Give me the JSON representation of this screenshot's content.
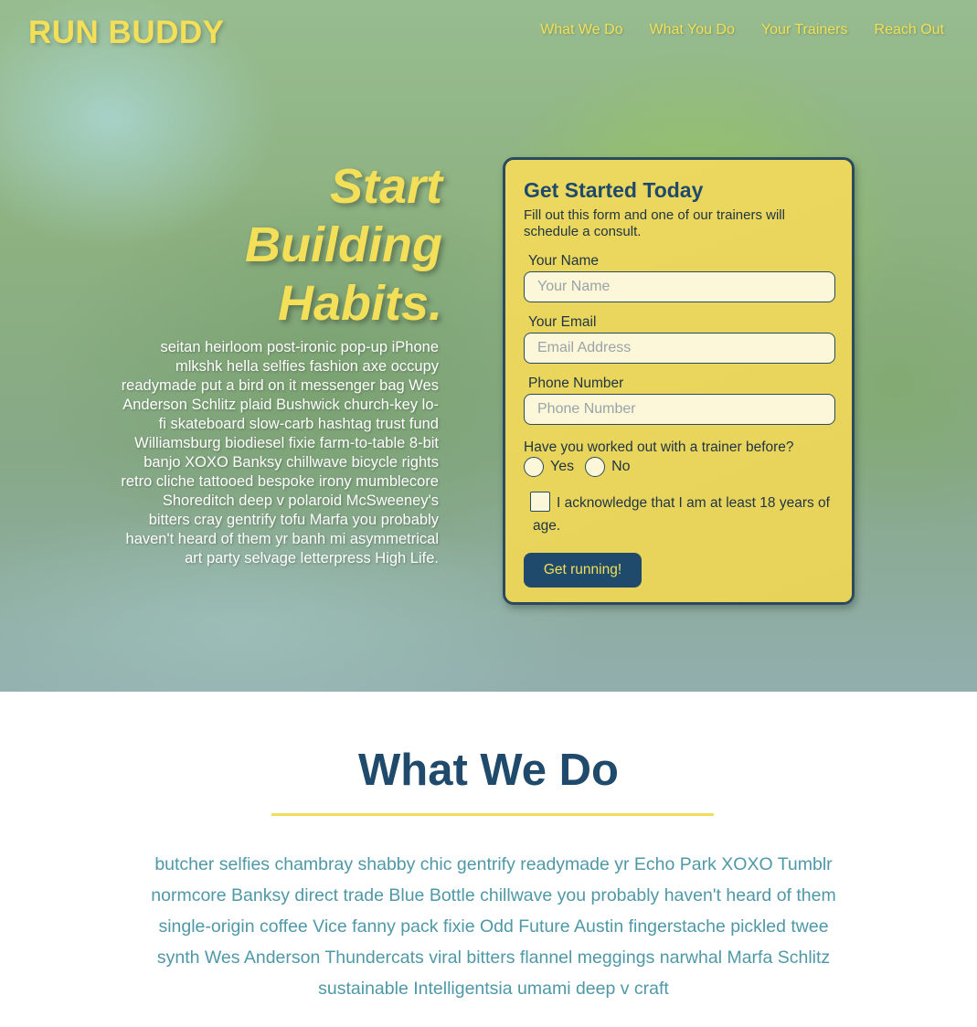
{
  "brand": "RUN BUDDY",
  "nav": [
    "What We Do",
    "What You Do",
    "Your Trainers",
    "Reach Out"
  ],
  "hero": {
    "headline": [
      "Start",
      "Building",
      "Habits."
    ],
    "intro": "seitan heirloom post-ironic pop-up iPhone mlkshk hella selfies fashion axe occupy readymade put a bird on it messenger bag Wes Anderson Schlitz plaid Bushwick church-key lo-fi skateboard slow-carb hashtag trust fund Williamsburg biodiesel fixie farm-to-table 8-bit banjo XOXO Banksy chillwave bicycle rights retro cliche tattooed bespoke irony mumblecore Shoreditch deep v polaroid McSweeney's bitters cray gentrify tofu Marfa you probably haven't heard of them yr banh mi asymmetrical art party selvage letterpress High Life."
  },
  "form": {
    "title": "Get Started Today",
    "subtitle": "Fill out this form and one of our trainers will schedule a consult.",
    "name_label": "Your Name",
    "name_placeholder": "Your Name",
    "email_label": "Your Email",
    "email_placeholder": "Email Address",
    "phone_label": "Phone Number",
    "phone_placeholder": "Phone Number",
    "question": "Have you worked out with a trainer before?",
    "yes_label": "Yes",
    "no_label": "No",
    "acknowledge": "I acknowledge that I am at least 18 years of age.",
    "submit_label": "Get running!"
  },
  "what_we_do": {
    "title": "What We Do",
    "body": "butcher selfies chambray shabby chic gentrify readymade yr Echo Park XOXO Tumblr normcore Banksy direct trade Blue Bottle chillwave you probably haven't heard of them single-origin coffee Vice fanny pack fixie Odd Future Austin fingerstache pickled twee synth Wes Anderson Thundercats viral bitters flannel meggings narwhal Marfa Schlitz sustainable Intelligentsia umami deep v craft"
  },
  "colors": {
    "accent_yellow": "#f3df58",
    "navy": "#1f4a6b",
    "teal_text": "#4f98a6"
  }
}
